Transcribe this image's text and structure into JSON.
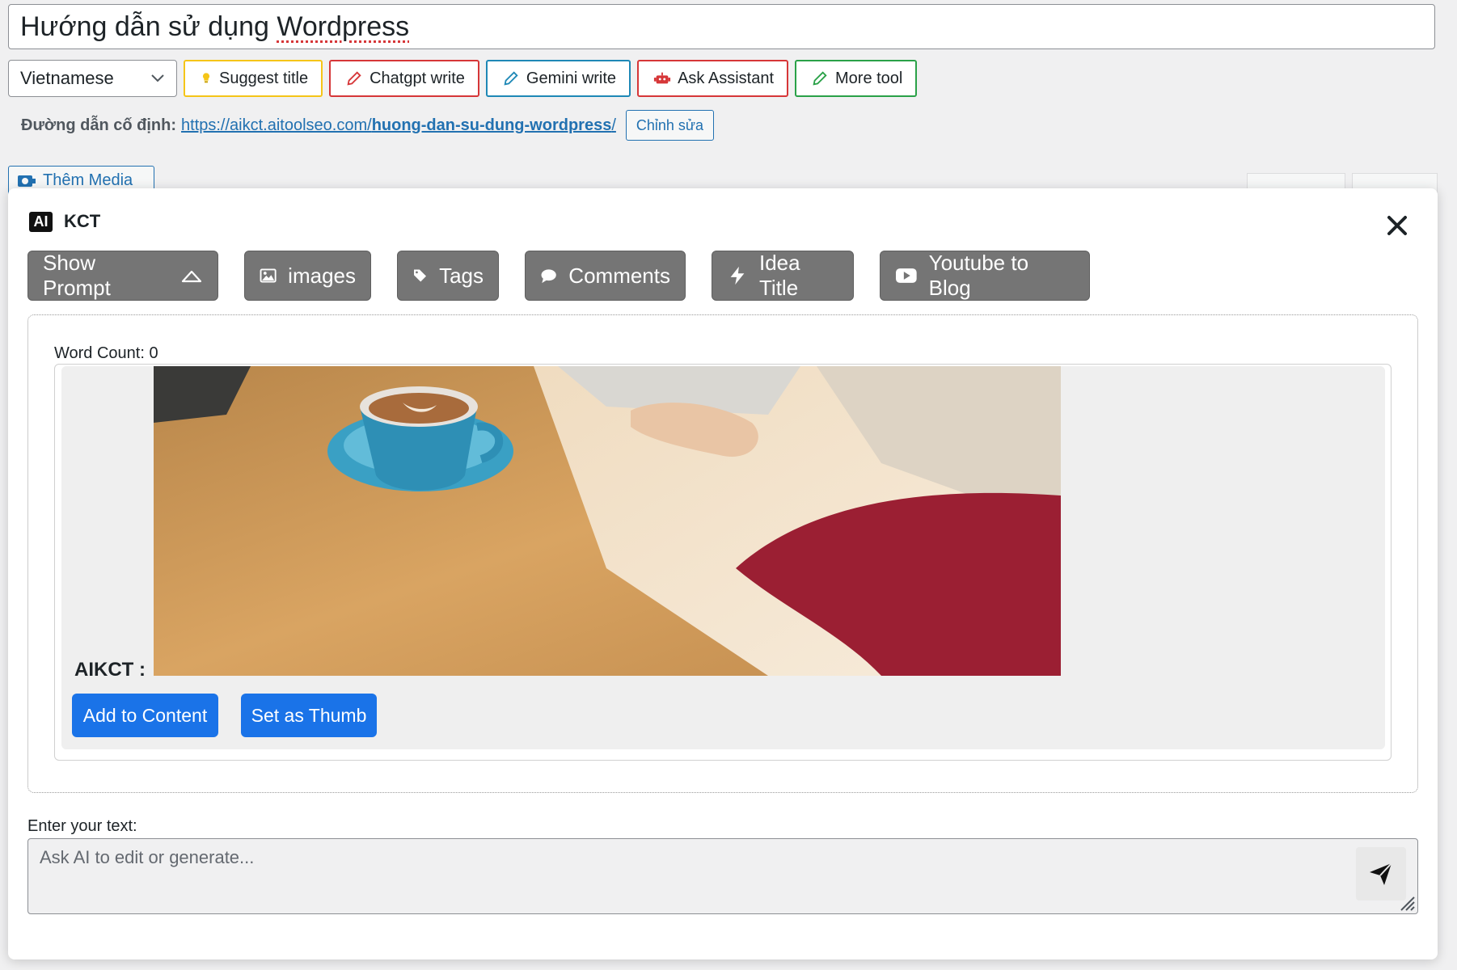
{
  "post": {
    "title_prefix": "Hướng dẫn sử dụng ",
    "title_misspelled": "Wordpress",
    "permalink_label": "Đường dẫn cố định:",
    "permalink_base": "https://aikct.aitoolseo.com/",
    "permalink_slug": "huong-dan-su-dung-wordpress",
    "permalink_suffix": "/",
    "edit_label": "Chỉnh sửa",
    "add_media_label": "Thêm Media"
  },
  "toolbar": {
    "language": "Vietnamese",
    "buttons": [
      {
        "label": "Suggest title",
        "icon": "lightbulb-icon",
        "color": "#f5c518"
      },
      {
        "label": "Chatgpt write",
        "icon": "pencil-icon",
        "color": "#d63638"
      },
      {
        "label": "Gemini write",
        "icon": "pencil-icon",
        "color": "#1e88b6"
      },
      {
        "label": "Ask Assistant",
        "icon": "robot-icon",
        "color": "#d63638"
      },
      {
        "label": "More tool",
        "icon": "pencil-icon",
        "color": "#2aa148"
      }
    ]
  },
  "modal": {
    "logo": "AI",
    "title": "KCT",
    "tabs": [
      {
        "label": "Show Prompt",
        "icon": "chevron-up-icon"
      },
      {
        "label": "images",
        "icon": "image-icon"
      },
      {
        "label": "Tags",
        "icon": "tag-icon"
      },
      {
        "label": "Comments",
        "icon": "comment-icon"
      },
      {
        "label": "Idea Title",
        "icon": "bolt-icon"
      },
      {
        "label": "Youtube to Blog",
        "icon": "youtube-icon"
      }
    ],
    "word_count": "Word Count: 0",
    "result_label": "AIKCT :",
    "add_to_content": "Add to Content",
    "set_as_thumb": "Set as Thumb",
    "input_label": "Enter your text:",
    "input_placeholder": "Ask AI to edit or generate..."
  },
  "colors": {
    "primary": "#1a73e8",
    "tab_bg": "#757575",
    "link": "#2271b1"
  }
}
